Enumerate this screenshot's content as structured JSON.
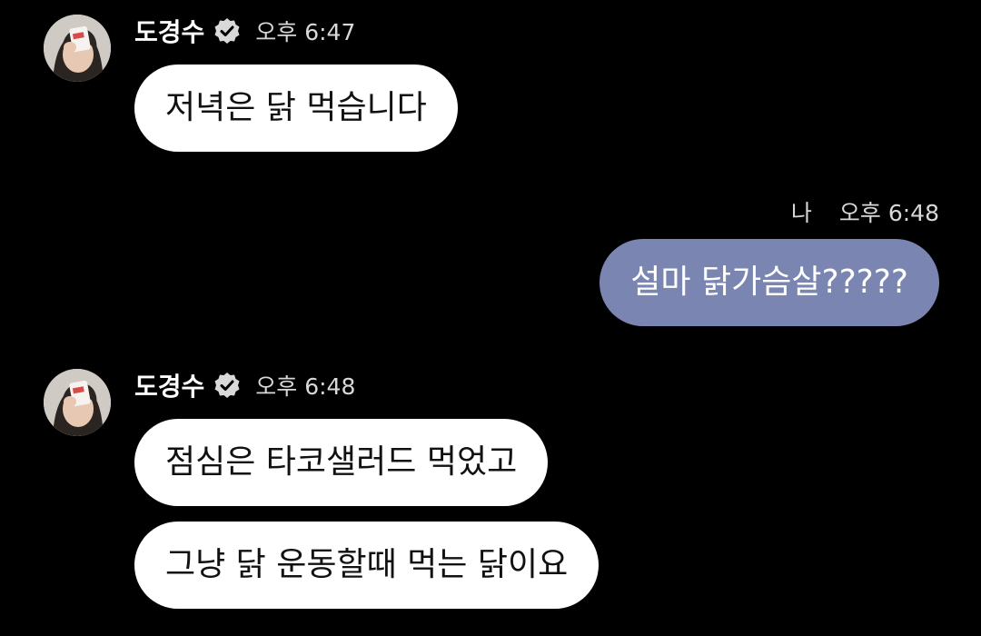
{
  "colors": {
    "background": "#000000",
    "incoming_bubble": "#ffffff",
    "outgoing_bubble": "#7a85b2"
  },
  "messages": [
    {
      "sender": "도경수",
      "verified_icon": "verified-badge-icon",
      "time": "오후 6:47",
      "bubbles": [
        "저녁은 닭 먹습니다"
      ]
    },
    {
      "sender": "나",
      "time": "오후 6:48",
      "bubbles": [
        "설마 닭가슴살?????"
      ]
    },
    {
      "sender": "도경수",
      "verified_icon": "verified-badge-icon",
      "time": "오후 6:48",
      "bubbles": [
        "점심은 타코샐러드 먹었고",
        "그냥 닭 운동할때 먹는 닭이요"
      ]
    }
  ]
}
